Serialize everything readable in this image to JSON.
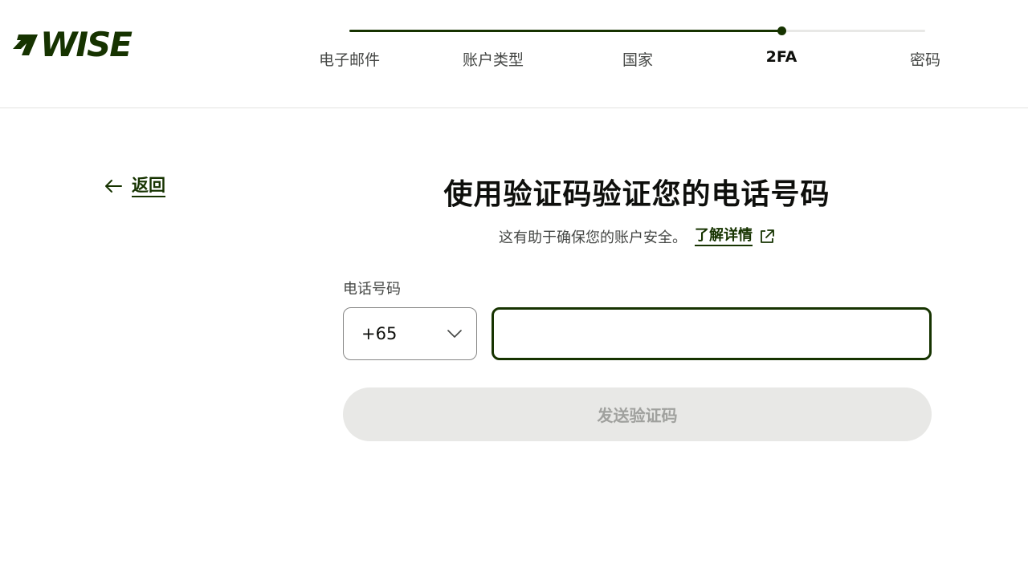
{
  "brand": {
    "name": "WISE",
    "color": "#163300"
  },
  "progress": {
    "steps": [
      "电子邮件",
      "账户类型",
      "国家",
      "2FA",
      "密码"
    ],
    "current_step_index": 3,
    "fraction_complete": 0.75
  },
  "back": {
    "label": "返回",
    "icon": "arrow-left-icon"
  },
  "main": {
    "title": "使用验证码验证您的电话号码",
    "subtitle": "这有助于确保您的账户安全。",
    "learn_more": "了解详情",
    "learn_more_icon": "external-link-icon"
  },
  "form": {
    "phone_label": "电话号码",
    "country_code": "+65",
    "phone_value": "",
    "phone_placeholder": "",
    "send_button": "发送验证码"
  }
}
